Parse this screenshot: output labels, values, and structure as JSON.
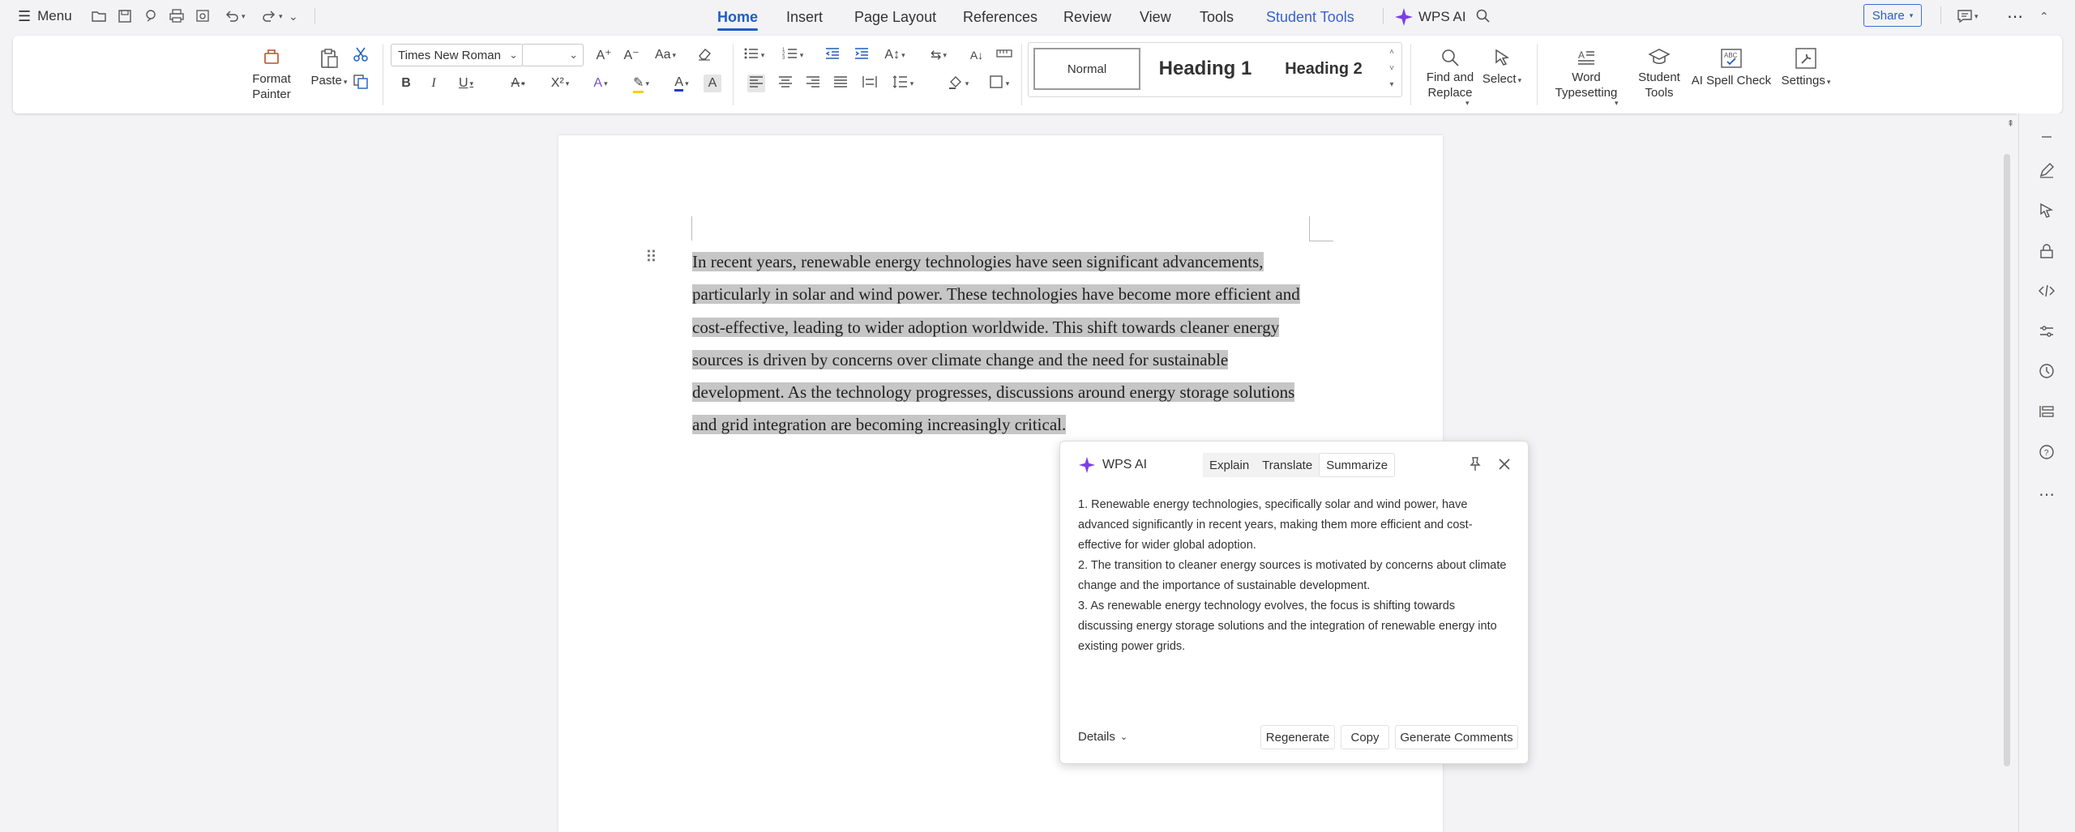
{
  "topbar": {
    "menu_label": "Menu",
    "tabs": [
      {
        "label": "Home",
        "active": true
      },
      {
        "label": "Insert"
      },
      {
        "label": "Page Layout"
      },
      {
        "label": "References"
      },
      {
        "label": "Review"
      },
      {
        "label": "View"
      },
      {
        "label": "Tools"
      },
      {
        "label": "Student Tools"
      }
    ],
    "wps_ai_label": "WPS AI",
    "share_label": "Share"
  },
  "ribbon": {
    "format_painter": "Format Painter",
    "paste": "Paste",
    "font_name": "Times New Roman",
    "font_size": "",
    "styles": {
      "normal": "Normal",
      "heading1": "Heading 1",
      "heading2": "Heading 2"
    },
    "find_replace": "Find and Replace",
    "select": "Select",
    "word_typesetting": "Word Typesetting",
    "student_tools": "Student Tools",
    "ai_spell_check": "AI Spell Check",
    "settings": "Settings"
  },
  "document": {
    "paragraph": "In recent years, renewable energy technologies have seen significant advancements, particularly in solar and wind power. These technologies have become more efficient and cost-effective, leading to wider adoption worldwide. This shift towards cleaner energy sources is driven by concerns over climate change and the need for sustainable development. As the technology progresses, discussions around energy storage solutions and grid integration are becoming increasingly critical."
  },
  "ai_panel": {
    "title": "WPS AI",
    "modes": [
      "Explain",
      "Translate",
      "Summarize"
    ],
    "results": [
      "1. Renewable energy technologies, specifically solar and wind power, have advanced significantly in recent years, making them more efficient and cost-effective for wider global adoption.",
      "2. The transition to cleaner energy sources is motivated by concerns about climate change and the importance of sustainable development.",
      "3. As renewable energy technology evolves, the focus is shifting towards discussing energy storage solutions and the integration of renewable energy into existing power grids."
    ],
    "details_label": "Details",
    "regenerate_label": "Regenerate",
    "copy_label": "Copy",
    "generate_comments_label": "Generate Comments"
  },
  "colors": {
    "accent": "#1f5fbf",
    "selection": "#c6c6c6",
    "ai_purple": "#7b3fe4"
  }
}
